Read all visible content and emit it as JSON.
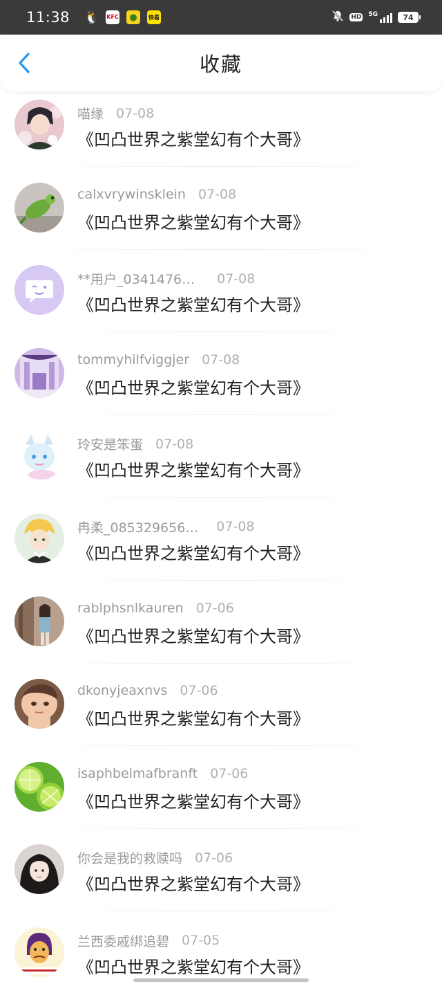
{
  "status_bar": {
    "time": "11:38",
    "network": "5G",
    "hd": "HD",
    "battery": "74",
    "apps": [
      {
        "icon": "qq-penguin-icon",
        "glyph": "🐧"
      },
      {
        "icon": "kfc-icon",
        "glyph": "KFC"
      },
      {
        "icon": "lemon-app-icon",
        "glyph": "●"
      },
      {
        "icon": "kuaikan-icon",
        "glyph": "快看"
      }
    ]
  },
  "header": {
    "back_icon": "chevron-left-icon",
    "title": "收藏",
    "accent_color": "#2196f3"
  },
  "items": [
    {
      "username": "喵缘",
      "date": "07-08",
      "title": "《凹凸世界之紫堂幻有个大哥》",
      "avatar": "anime-boy-flowers"
    },
    {
      "username": "calxvrywinsklein",
      "date": "07-08",
      "title": "《凹凸世界之紫堂幻有个大哥》",
      "avatar": "green-parrot"
    },
    {
      "username": "**用户_0341476…",
      "date": "07-08",
      "title": "《凹凸世界之紫堂幻有个大哥》",
      "avatar": "default-chat-bubble"
    },
    {
      "username": "tommyhilfviggjer",
      "date": "07-08",
      "title": "《凹凸世界之紫堂幻有个大哥》",
      "avatar": "purple-stage"
    },
    {
      "username": "玲安是笨蛋",
      "date": "07-08",
      "title": "《凹凸世界之紫堂幻有个大哥》",
      "avatar": "anime-cat-ears"
    },
    {
      "username": "冉柔_085329656…",
      "date": "07-08",
      "title": "《凹凸世界之紫堂幻有个大哥》",
      "avatar": "anime-blonde"
    },
    {
      "username": "rablphsnlkauren",
      "date": "07-06",
      "title": "《凹凸世界之紫堂幻有个大哥》",
      "avatar": "girl-by-tree"
    },
    {
      "username": "dkonyjeaxnvs",
      "date": "07-06",
      "title": "《凹凸世界之紫堂幻有个大哥》",
      "avatar": "child-face"
    },
    {
      "username": "isaphbelmafbranft",
      "date": "07-06",
      "title": "《凹凸世界之紫堂幻有个大哥》",
      "avatar": "lime-slices"
    },
    {
      "username": "你会是我的救赎吗",
      "date": "07-06",
      "title": "《凹凸世界之紫堂幻有个大哥》",
      "avatar": "girl-dark-hair"
    },
    {
      "username": "兰西委戚绑追碧",
      "date": "07-05",
      "title": "《凹凸世界之紫堂幻有个大哥》",
      "avatar": "cartoon-meme"
    }
  ]
}
